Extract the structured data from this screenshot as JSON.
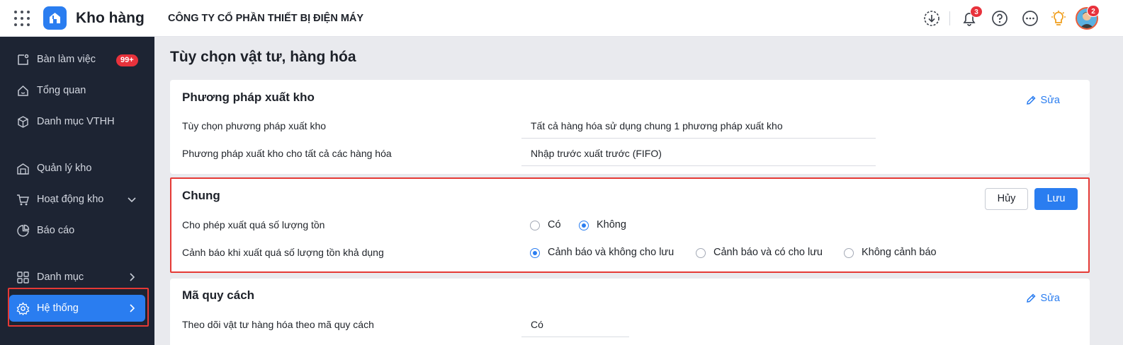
{
  "topbar": {
    "app_title": "Kho hàng",
    "company": "CÔNG TY CỔ PHẦN THIẾT BỊ ĐIỆN MÁY",
    "notifications_count": "3",
    "avatar_badge": "2"
  },
  "sidebar": {
    "items": [
      {
        "label": "Bàn làm việc",
        "badge": "99+"
      },
      {
        "label": "Tổng quan"
      },
      {
        "label": "Danh mục VTHH"
      },
      {
        "label": "Quản lý kho"
      },
      {
        "label": "Hoạt động kho"
      },
      {
        "label": "Báo cáo"
      },
      {
        "label": "Danh mục"
      },
      {
        "label": "Hệ thống"
      }
    ]
  },
  "page": {
    "title": "Tùy chọn vật tư, hàng hóa"
  },
  "section_export": {
    "title": "Phương pháp xuất kho",
    "edit_label": "Sửa",
    "rows": [
      {
        "label": "Tùy chọn phương pháp xuất kho",
        "value": "Tất cả hàng hóa sử dụng chung 1 phương pháp xuất kho"
      },
      {
        "label": "Phương pháp xuất kho cho tất cả các hàng hóa",
        "value": "Nhập trước xuất trước (FIFO)"
      }
    ]
  },
  "section_general": {
    "title": "Chung",
    "cancel_label": "Hủy",
    "save_label": "Lưu",
    "row1": {
      "label": "Cho phép xuất quá số lượng tồn",
      "options": [
        "Có",
        "Không"
      ],
      "selected": "Không"
    },
    "row2": {
      "label": "Cảnh báo khi xuất quá số lượng tồn khả dụng",
      "options": [
        "Cảnh báo và không cho lưu",
        "Cảnh báo và có cho lưu",
        "Không cảnh báo"
      ],
      "selected": "Cảnh báo và không cho lưu"
    }
  },
  "section_spec": {
    "title": "Mã quy cách",
    "edit_label": "Sửa",
    "rows": [
      {
        "label": "Theo dõi vật tư hàng hóa theo mã quy cách",
        "value": "Có"
      }
    ]
  },
  "colors": {
    "accent": "#2a7df0",
    "sidebar_bg": "#1d2433",
    "highlight": "#e53935",
    "badge": "#e8323c"
  }
}
